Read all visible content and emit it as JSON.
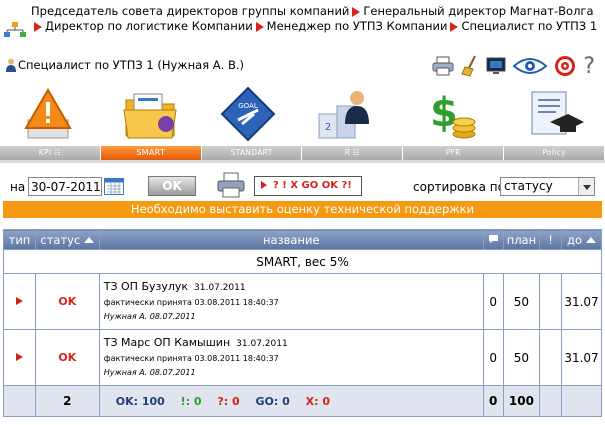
{
  "breadcrumb": {
    "items": [
      "Председатель совета директоров группы компаний",
      "Генеральный директор Магнат-Волга",
      "Директор по логистике Компании",
      "Менеджер по УТПЗ Компании",
      "Специалист по УТПЗ 1"
    ]
  },
  "user": {
    "name": "Специалист по УТПЗ 1  (Нужная А. В.)"
  },
  "tools": {
    "help_label": "?"
  },
  "tabs": [
    {
      "label": "KPI  ☷",
      "active": false
    },
    {
      "label": "SMART",
      "active": true
    },
    {
      "label": "STANDART",
      "active": false
    },
    {
      "label": "R  ☷",
      "active": false
    },
    {
      "label": "PFR",
      "active": false
    },
    {
      "label": "Policy",
      "active": false
    }
  ],
  "toolbar": {
    "date_label": "на",
    "date_value": "30-07-2011",
    "ok_label": "OK",
    "status_text": "? ! X GO OK ?!",
    "sort_label": "сортировка по",
    "sort_value": "статусу"
  },
  "banner": {
    "text": "Необходимо выставить оценку технической поддержки"
  },
  "table": {
    "headers": {
      "type": "тип",
      "status": "статус",
      "name": "название",
      "plan": "план",
      "excl": "!",
      "due": "до"
    },
    "group_title": "SMART, вес 5%",
    "rows": [
      {
        "status": "OK",
        "title": "ТЗ ОП Бузулук",
        "title_date": "31.07.2011",
        "accepted": "фактически принята 03.08.2011 18:40:37",
        "author": "Нужная А. 08.07.2011",
        "comments": "0",
        "plan": "50",
        "excl": "",
        "due": "31.07"
      },
      {
        "status": "OK",
        "title": "ТЗ Марс ОП Камышин",
        "title_date": "31.07.2011",
        "accepted": "фактически принята 03.08.2011 18:40:37",
        "author": "Нужная А. 08.07.2011",
        "comments": "0",
        "plan": "50",
        "excl": "",
        "due": "31.07"
      }
    ],
    "footer": {
      "count": "2",
      "ok": "OK: 100",
      "excl": "!: 0",
      "question": "?: 0",
      "go": "GO: 0",
      "x": "X: 0",
      "comments": "0",
      "plan": "100"
    }
  },
  "colors": {
    "accent_orange": "#f59a12",
    "ok_red": "#d6241c",
    "header_blue": "#6b84b0"
  }
}
